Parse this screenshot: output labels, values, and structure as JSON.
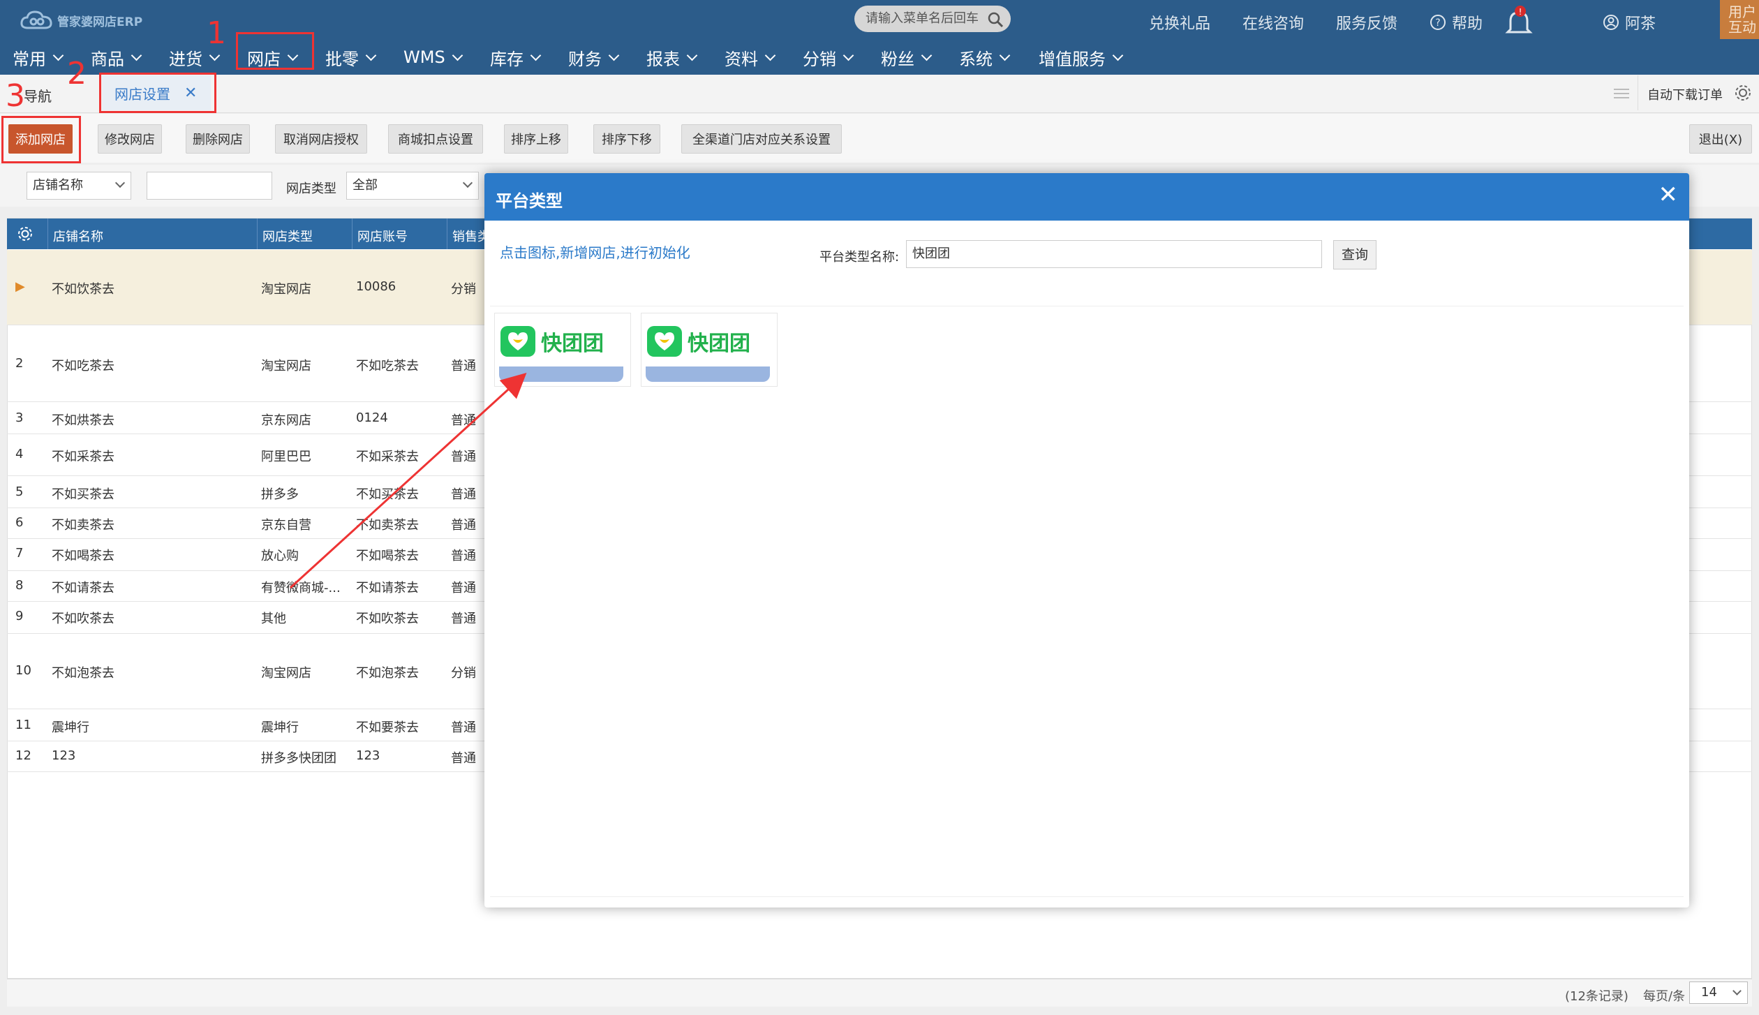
{
  "app": {
    "logo": "管家婆网店ERP"
  },
  "search": {
    "placeholder": "请输入菜单名后回车"
  },
  "toplinks": {
    "gift": "兑换礼品",
    "consult": "在线咨询",
    "feedback": "服务反馈",
    "help": "帮助",
    "user": "阿茶",
    "interact_line1": "用户",
    "interact_line2": "互动"
  },
  "menu": [
    "常用",
    "商品",
    "进货",
    "网店",
    "批零",
    "WMS",
    "库存",
    "财务",
    "报表",
    "资料",
    "分销",
    "粉丝",
    "系统",
    "增值服务"
  ],
  "annotations": {
    "n1": "1",
    "n2": "2",
    "n3": "3"
  },
  "tabs": {
    "nav": "导航",
    "active": "网店设置",
    "auto_download": "自动下载订单"
  },
  "toolbar": [
    "添加网店",
    "修改网店",
    "删除网店",
    "取消网店授权",
    "商城扣点设置",
    "排序上移",
    "排序下移",
    "全渠道门店对应关系设置"
  ],
  "exit_button": "退出(X)",
  "filter": {
    "field": "店铺名称",
    "type_label": "网店类型",
    "type_value": "全部"
  },
  "grid": {
    "headers": [
      "店铺名称",
      "网店类型",
      "网店账号",
      "销售类"
    ],
    "rows": [
      {
        "num": "",
        "name": "不如饮茶去",
        "type": "淘宝网店",
        "account": "10086",
        "sale": "分销"
      },
      {
        "num": "2",
        "name": "不如吃茶去",
        "type": "淘宝网店",
        "account": "不如吃茶去",
        "sale": "普通"
      },
      {
        "num": "3",
        "name": "不如烘茶去",
        "type": "京东网店",
        "account": "0124",
        "sale": "普通"
      },
      {
        "num": "4",
        "name": "不如采茶去",
        "type": "阿里巴巴",
        "account": "不如采茶去",
        "sale": "普通"
      },
      {
        "num": "5",
        "name": "不如买茶去",
        "type": "拼多多",
        "account": "不如买茶去",
        "sale": "普通"
      },
      {
        "num": "6",
        "name": "不如卖茶去",
        "type": "京东自营",
        "account": "不如卖茶去",
        "sale": "普通"
      },
      {
        "num": "7",
        "name": "不如喝茶去",
        "type": "放心购",
        "account": "不如喝茶去",
        "sale": "普通"
      },
      {
        "num": "8",
        "name": "不如请茶去",
        "type": "有赞微商城-...",
        "account": "不如请茶去",
        "sale": "普通"
      },
      {
        "num": "9",
        "name": "不如吹茶去",
        "type": "其他",
        "account": "不如吹茶去",
        "sale": "普通"
      },
      {
        "num": "10",
        "name": "不如泡茶去",
        "type": "淘宝网店",
        "account": "不如泡茶去",
        "sale": "分销"
      },
      {
        "num": "11",
        "name": "震坤行",
        "type": "震坤行",
        "account": "不如要茶去",
        "sale": "普通"
      },
      {
        "num": "12",
        "name": "123",
        "type": "拼多多快团团",
        "account": "123",
        "sale": "普通"
      }
    ]
  },
  "footer": {
    "records": "(12条记录)",
    "per_page_label": "每页/条",
    "per_page": "14"
  },
  "modal": {
    "title": "平台类型",
    "hint": "点击图标,新增网店,进行初始化",
    "search_label": "平台类型名称:",
    "search_value": "快团团",
    "query_button": "查询",
    "platforms": [
      {
        "name": "快团团"
      },
      {
        "name": "快团团"
      }
    ]
  },
  "colors": {
    "header": "#2c5c8a",
    "grid_header": "#2d6aa3",
    "modal_header": "#2b7ac9",
    "primary_btn": "#c8562d",
    "annotation": "#ee3333"
  }
}
